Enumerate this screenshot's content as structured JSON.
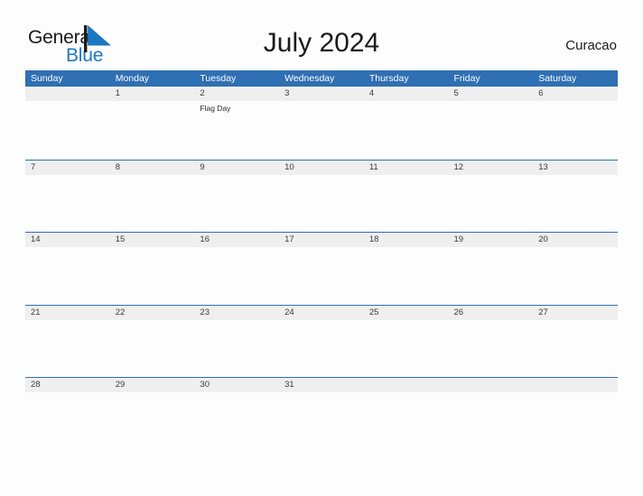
{
  "brand": {
    "name_part1": "General",
    "name_part2": "Blue",
    "flag_icon": "flag-triangle-icon",
    "flag_color": "#1c77c3",
    "pole_color": "#1b1b1b"
  },
  "header": {
    "title": "July 2024",
    "locale": "Curacao"
  },
  "colors": {
    "header_blue": "#2f6fb3",
    "date_band_gray": "#efefef",
    "page_background": "#fdfdfd",
    "text_dark": "#1b1b1b",
    "brand_blue": "#1c77c3"
  },
  "calendar": {
    "month": "July",
    "year": "2024",
    "day_headers": [
      "Sunday",
      "Monday",
      "Tuesday",
      "Wednesday",
      "Thursday",
      "Friday",
      "Saturday"
    ],
    "weeks": [
      {
        "days": [
          {
            "date": "",
            "events": []
          },
          {
            "date": "1",
            "events": []
          },
          {
            "date": "2",
            "events": [
              "Flag Day"
            ]
          },
          {
            "date": "3",
            "events": []
          },
          {
            "date": "4",
            "events": []
          },
          {
            "date": "5",
            "events": []
          },
          {
            "date": "6",
            "events": []
          }
        ]
      },
      {
        "days": [
          {
            "date": "7",
            "events": []
          },
          {
            "date": "8",
            "events": []
          },
          {
            "date": "9",
            "events": []
          },
          {
            "date": "10",
            "events": []
          },
          {
            "date": "11",
            "events": []
          },
          {
            "date": "12",
            "events": []
          },
          {
            "date": "13",
            "events": []
          }
        ]
      },
      {
        "days": [
          {
            "date": "14",
            "events": []
          },
          {
            "date": "15",
            "events": []
          },
          {
            "date": "16",
            "events": []
          },
          {
            "date": "17",
            "events": []
          },
          {
            "date": "18",
            "events": []
          },
          {
            "date": "19",
            "events": []
          },
          {
            "date": "20",
            "events": []
          }
        ]
      },
      {
        "days": [
          {
            "date": "21",
            "events": []
          },
          {
            "date": "22",
            "events": []
          },
          {
            "date": "23",
            "events": []
          },
          {
            "date": "24",
            "events": []
          },
          {
            "date": "25",
            "events": []
          },
          {
            "date": "26",
            "events": []
          },
          {
            "date": "27",
            "events": []
          }
        ]
      },
      {
        "days": [
          {
            "date": "28",
            "events": []
          },
          {
            "date": "29",
            "events": []
          },
          {
            "date": "30",
            "events": []
          },
          {
            "date": "31",
            "events": []
          },
          {
            "date": "",
            "events": []
          },
          {
            "date": "",
            "events": []
          },
          {
            "date": "",
            "events": []
          }
        ]
      }
    ]
  }
}
